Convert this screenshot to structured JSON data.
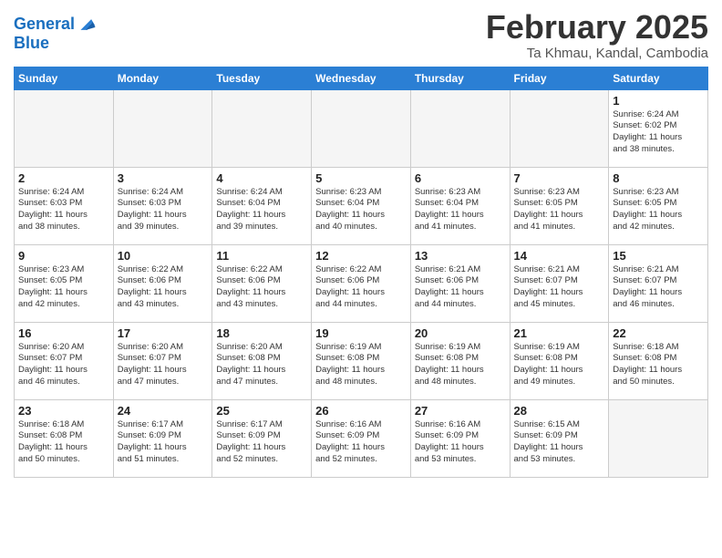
{
  "header": {
    "logo_line1": "General",
    "logo_line2": "Blue",
    "month": "February 2025",
    "location": "Ta Khmau, Kandal, Cambodia"
  },
  "weekdays": [
    "Sunday",
    "Monday",
    "Tuesday",
    "Wednesday",
    "Thursday",
    "Friday",
    "Saturday"
  ],
  "weeks": [
    [
      {
        "day": "",
        "info": ""
      },
      {
        "day": "",
        "info": ""
      },
      {
        "day": "",
        "info": ""
      },
      {
        "day": "",
        "info": ""
      },
      {
        "day": "",
        "info": ""
      },
      {
        "day": "",
        "info": ""
      },
      {
        "day": "1",
        "info": "Sunrise: 6:24 AM\nSunset: 6:02 PM\nDaylight: 11 hours\nand 38 minutes."
      }
    ],
    [
      {
        "day": "2",
        "info": "Sunrise: 6:24 AM\nSunset: 6:03 PM\nDaylight: 11 hours\nand 38 minutes."
      },
      {
        "day": "3",
        "info": "Sunrise: 6:24 AM\nSunset: 6:03 PM\nDaylight: 11 hours\nand 39 minutes."
      },
      {
        "day": "4",
        "info": "Sunrise: 6:24 AM\nSunset: 6:04 PM\nDaylight: 11 hours\nand 39 minutes."
      },
      {
        "day": "5",
        "info": "Sunrise: 6:23 AM\nSunset: 6:04 PM\nDaylight: 11 hours\nand 40 minutes."
      },
      {
        "day": "6",
        "info": "Sunrise: 6:23 AM\nSunset: 6:04 PM\nDaylight: 11 hours\nand 41 minutes."
      },
      {
        "day": "7",
        "info": "Sunrise: 6:23 AM\nSunset: 6:05 PM\nDaylight: 11 hours\nand 41 minutes."
      },
      {
        "day": "8",
        "info": "Sunrise: 6:23 AM\nSunset: 6:05 PM\nDaylight: 11 hours\nand 42 minutes."
      }
    ],
    [
      {
        "day": "9",
        "info": "Sunrise: 6:23 AM\nSunset: 6:05 PM\nDaylight: 11 hours\nand 42 minutes."
      },
      {
        "day": "10",
        "info": "Sunrise: 6:22 AM\nSunset: 6:06 PM\nDaylight: 11 hours\nand 43 minutes."
      },
      {
        "day": "11",
        "info": "Sunrise: 6:22 AM\nSunset: 6:06 PM\nDaylight: 11 hours\nand 43 minutes."
      },
      {
        "day": "12",
        "info": "Sunrise: 6:22 AM\nSunset: 6:06 PM\nDaylight: 11 hours\nand 44 minutes."
      },
      {
        "day": "13",
        "info": "Sunrise: 6:21 AM\nSunset: 6:06 PM\nDaylight: 11 hours\nand 44 minutes."
      },
      {
        "day": "14",
        "info": "Sunrise: 6:21 AM\nSunset: 6:07 PM\nDaylight: 11 hours\nand 45 minutes."
      },
      {
        "day": "15",
        "info": "Sunrise: 6:21 AM\nSunset: 6:07 PM\nDaylight: 11 hours\nand 46 minutes."
      }
    ],
    [
      {
        "day": "16",
        "info": "Sunrise: 6:20 AM\nSunset: 6:07 PM\nDaylight: 11 hours\nand 46 minutes."
      },
      {
        "day": "17",
        "info": "Sunrise: 6:20 AM\nSunset: 6:07 PM\nDaylight: 11 hours\nand 47 minutes."
      },
      {
        "day": "18",
        "info": "Sunrise: 6:20 AM\nSunset: 6:08 PM\nDaylight: 11 hours\nand 47 minutes."
      },
      {
        "day": "19",
        "info": "Sunrise: 6:19 AM\nSunset: 6:08 PM\nDaylight: 11 hours\nand 48 minutes."
      },
      {
        "day": "20",
        "info": "Sunrise: 6:19 AM\nSunset: 6:08 PM\nDaylight: 11 hours\nand 48 minutes."
      },
      {
        "day": "21",
        "info": "Sunrise: 6:19 AM\nSunset: 6:08 PM\nDaylight: 11 hours\nand 49 minutes."
      },
      {
        "day": "22",
        "info": "Sunrise: 6:18 AM\nSunset: 6:08 PM\nDaylight: 11 hours\nand 50 minutes."
      }
    ],
    [
      {
        "day": "23",
        "info": "Sunrise: 6:18 AM\nSunset: 6:08 PM\nDaylight: 11 hours\nand 50 minutes."
      },
      {
        "day": "24",
        "info": "Sunrise: 6:17 AM\nSunset: 6:09 PM\nDaylight: 11 hours\nand 51 minutes."
      },
      {
        "day": "25",
        "info": "Sunrise: 6:17 AM\nSunset: 6:09 PM\nDaylight: 11 hours\nand 52 minutes."
      },
      {
        "day": "26",
        "info": "Sunrise: 6:16 AM\nSunset: 6:09 PM\nDaylight: 11 hours\nand 52 minutes."
      },
      {
        "day": "27",
        "info": "Sunrise: 6:16 AM\nSunset: 6:09 PM\nDaylight: 11 hours\nand 53 minutes."
      },
      {
        "day": "28",
        "info": "Sunrise: 6:15 AM\nSunset: 6:09 PM\nDaylight: 11 hours\nand 53 minutes."
      },
      {
        "day": "",
        "info": ""
      }
    ]
  ]
}
